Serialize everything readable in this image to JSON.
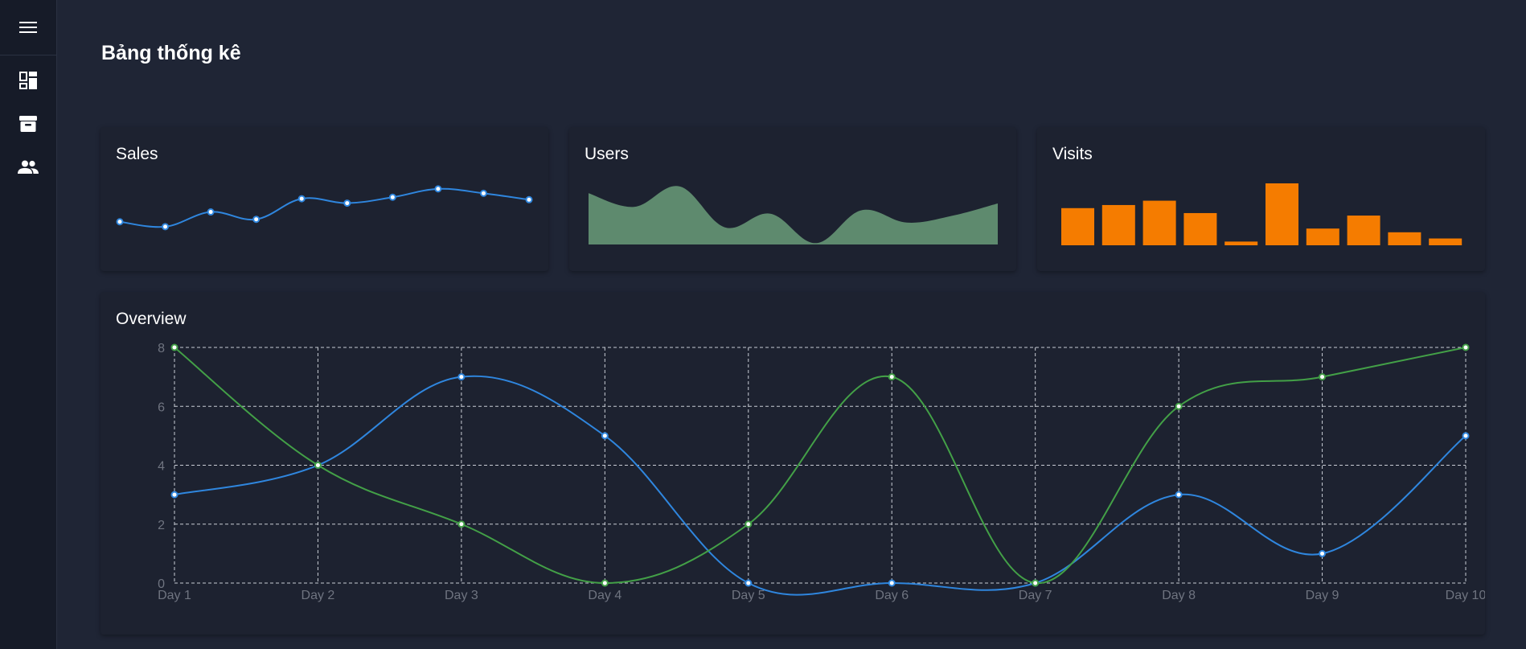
{
  "page": {
    "title": "Bảng thống kê"
  },
  "sidebar": {
    "menu_icon": "menu-icon",
    "items": [
      {
        "name": "dashboard",
        "icon": "dashboard-icon"
      },
      {
        "name": "archive",
        "icon": "archive-icon"
      },
      {
        "name": "users",
        "icon": "people-icon"
      }
    ]
  },
  "colors": {
    "blue": "#2f86de",
    "green": "#43a047",
    "area": "#5e8a6e",
    "orange": "#f57c00",
    "grid": "#c8ccd4"
  },
  "cards": {
    "sales": {
      "title": "Sales",
      "chart_data": {
        "type": "line",
        "values": [
          4.5,
          3.5,
          6.5,
          5.0,
          9.2,
          8.3,
          9.5,
          11.2,
          10.3,
          9.0
        ]
      }
    },
    "users": {
      "title": "Users",
      "chart_data": {
        "type": "area",
        "values": [
          7.5,
          5.5,
          8.5,
          2.5,
          4.5,
          0.2,
          5.0,
          3.2,
          4.2,
          6.0
        ]
      }
    },
    "visits": {
      "title": "Visits",
      "chart_data": {
        "type": "bar",
        "values": [
          6,
          6.5,
          7.2,
          5.2,
          0.6,
          10,
          2.7,
          4.8,
          2.1,
          1.1
        ]
      }
    }
  },
  "overview": {
    "title": "Overview",
    "chart_data": {
      "type": "line",
      "categories": [
        "Day 1",
        "Day 2",
        "Day 3",
        "Day 4",
        "Day 5",
        "Day 6",
        "Day 7",
        "Day 8",
        "Day 9",
        "Day 10"
      ],
      "ylim": [
        0,
        8
      ],
      "yticks": [
        0,
        2,
        4,
        6,
        8
      ],
      "series": [
        {
          "color": "#2f86de",
          "values": [
            3,
            4,
            7,
            5,
            0,
            0,
            0,
            3,
            1,
            5
          ]
        },
        {
          "color": "#43a047",
          "values": [
            8,
            4,
            2,
            0,
            2,
            7,
            0,
            6,
            7,
            8
          ]
        }
      ],
      "grid": true
    }
  }
}
